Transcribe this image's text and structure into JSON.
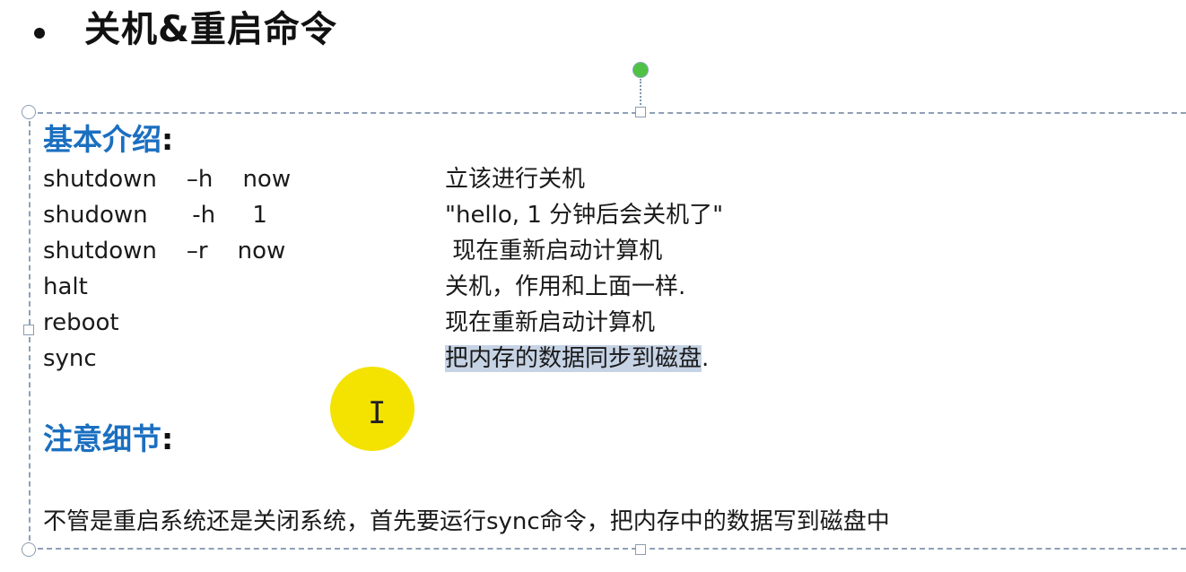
{
  "slide": {
    "title": "关机&重启命令"
  },
  "basic_intro": {
    "heading": "基本介绍",
    "colon": ":",
    "commands": [
      {
        "cmd": "shutdown    –h    now",
        "desc": "立该进行关机"
      },
      {
        "cmd": "shudown      -h     1",
        "desc": "\"hello, 1 分钟后会关机了\""
      },
      {
        "cmd": "shutdown    –r    now",
        "desc": " 现在重新启动计算机"
      },
      {
        "cmd": "halt",
        "desc": "关机，作用和上面一样."
      },
      {
        "cmd": "reboot",
        "desc": "现在重新启动计算机"
      },
      {
        "cmd": "sync",
        "desc_selected": "把内存的数据同步到磁盘",
        "desc_rest": "."
      }
    ]
  },
  "notes": {
    "heading": "注意细节",
    "colon": ":",
    "text": "不管是重启系统还是关闭系统，首先要运行sync命令，把内存中的数据写到磁盘中"
  },
  "colors": {
    "heading_blue": "#1b6fc0",
    "selection_highlight": "#c6d3e5",
    "cursor_halo": "#f4e200",
    "rotate_handle": "#4fc246"
  },
  "icons": {
    "bullet": "bullet-dot-icon",
    "rotate": "rotate-handle-icon",
    "cursor": "text-cursor-icon"
  }
}
